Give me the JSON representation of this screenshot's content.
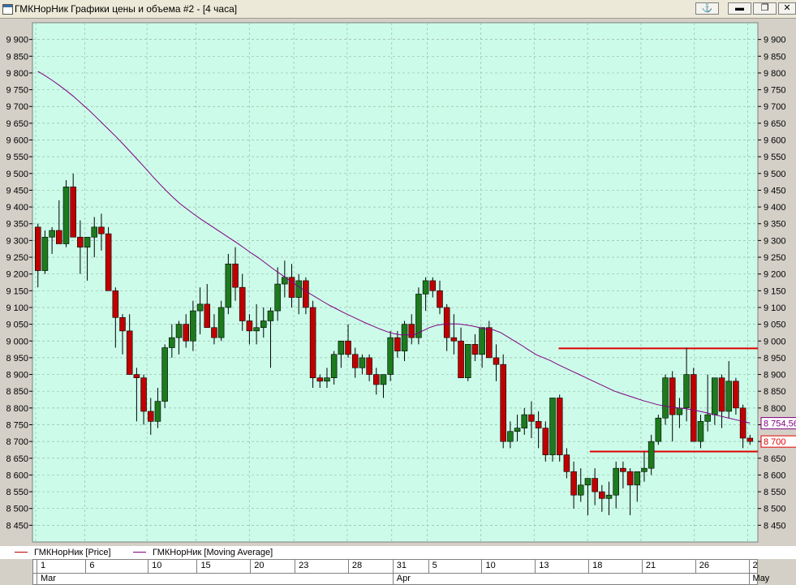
{
  "window": {
    "title": "ГМКНорНик Графики цены и объема #2 - [4 часа]"
  },
  "colors": {
    "background": "#ccfce9",
    "grid": "#9ab8ac",
    "up": "#1d7a1d",
    "down": "#c00000",
    "ma": "#800080",
    "level": "#e00000"
  },
  "chart_data": {
    "type": "candlestick",
    "title": "",
    "ylim": [
      8400,
      9950
    ],
    "y_ticks": [
      8450,
      8500,
      8550,
      8600,
      8650,
      8700,
      8750,
      8800,
      8850,
      8900,
      8950,
      9000,
      9050,
      9100,
      9150,
      9200,
      9250,
      9300,
      9350,
      9400,
      9450,
      9500,
      9550,
      9600,
      9650,
      9700,
      9750,
      9800,
      9850,
      9900
    ],
    "y_tick_labels": [
      "8 450",
      "8 500",
      "8 550",
      "8 600",
      "8 650",
      "8 700",
      "8 750",
      "8 800",
      "8 850",
      "8 900",
      "8 950",
      "9 000",
      "9 050",
      "9 100",
      "9 150",
      "9 200",
      "9 250",
      "9 300",
      "9 350",
      "9 400",
      "9 450",
      "9 500",
      "9 550",
      "9 600",
      "9 650",
      "9 700",
      "9 750",
      "9 800",
      "9 850",
      "9 900"
    ],
    "series": [
      {
        "name": "ГМКНорНик [Price]",
        "type": "candlestick",
        "candles": [
          [
            9340,
            9350,
            9160,
            9210
          ],
          [
            9210,
            9330,
            9200,
            9310
          ],
          [
            9310,
            9340,
            9260,
            9330
          ],
          [
            9330,
            9420,
            9300,
            9290
          ],
          [
            9290,
            9480,
            9280,
            9460
          ],
          [
            9460,
            9500,
            9320,
            9310
          ],
          [
            9310,
            9360,
            9200,
            9280
          ],
          [
            9280,
            9310,
            9180,
            9310
          ],
          [
            9310,
            9370,
            9250,
            9340
          ],
          [
            9340,
            9380,
            9270,
            9320
          ],
          [
            9320,
            9340,
            9180,
            9150
          ],
          [
            9150,
            9160,
            8980,
            9070
          ],
          [
            9070,
            9080,
            8960,
            9030
          ],
          [
            9030,
            9080,
            8980,
            8900
          ],
          [
            8900,
            8920,
            8760,
            8890
          ],
          [
            8890,
            8900,
            8750,
            8790
          ],
          [
            8790,
            8830,
            8720,
            8760
          ],
          [
            8760,
            8860,
            8740,
            8820
          ],
          [
            8820,
            8990,
            8800,
            8980
          ],
          [
            8980,
            9050,
            8950,
            9010
          ],
          [
            9010,
            9060,
            8960,
            9050
          ],
          [
            9050,
            9080,
            8980,
            9000
          ],
          [
            9000,
            9120,
            8970,
            9090
          ],
          [
            9090,
            9160,
            9020,
            9110
          ],
          [
            9110,
            9170,
            9060,
            9040
          ],
          [
            9040,
            9080,
            8990,
            9010
          ],
          [
            9010,
            9120,
            9000,
            9100
          ],
          [
            9100,
            9260,
            9080,
            9230
          ],
          [
            9230,
            9280,
            9120,
            9160
          ],
          [
            9160,
            9200,
            9030,
            9060
          ],
          [
            9060,
            9080,
            8990,
            9030
          ],
          [
            9030,
            9110,
            8990,
            9040
          ],
          [
            9040,
            9100,
            9010,
            9060
          ],
          [
            9060,
            9100,
            8920,
            9090
          ],
          [
            9090,
            9220,
            9060,
            9170
          ],
          [
            9170,
            9240,
            9130,
            9190
          ],
          [
            9190,
            9230,
            9100,
            9130
          ],
          [
            9130,
            9200,
            9080,
            9180
          ],
          [
            9180,
            9190,
            9080,
            9100
          ],
          [
            9100,
            9120,
            8860,
            8890
          ],
          [
            8890,
            8900,
            8860,
            8880
          ],
          [
            8880,
            8920,
            8860,
            8890
          ],
          [
            8890,
            8970,
            8870,
            8960
          ],
          [
            8960,
            9000,
            8920,
            9000
          ],
          [
            9000,
            9050,
            8950,
            8960
          ],
          [
            8960,
            8980,
            8890,
            8920
          ],
          [
            8920,
            8960,
            8900,
            8950
          ],
          [
            8950,
            8960,
            8880,
            8900
          ],
          [
            8900,
            8920,
            8840,
            8870
          ],
          [
            8870,
            8900,
            8830,
            8900
          ],
          [
            8900,
            9030,
            8880,
            9010
          ],
          [
            9010,
            9030,
            8950,
            8970
          ],
          [
            8970,
            9060,
            8940,
            9050
          ],
          [
            9050,
            9080,
            8990,
            9010
          ],
          [
            9010,
            9160,
            8990,
            9140
          ],
          [
            9140,
            9190,
            9090,
            9180
          ],
          [
            9180,
            9190,
            9130,
            9150
          ],
          [
            9150,
            9180,
            9080,
            9100
          ],
          [
            9100,
            9110,
            8970,
            9010
          ],
          [
            9010,
            9080,
            8960,
            9000
          ],
          [
            9000,
            9040,
            8910,
            8890
          ],
          [
            8890,
            8960,
            8880,
            8990
          ],
          [
            8990,
            9020,
            8940,
            8960
          ],
          [
            8960,
            9040,
            8920,
            9040
          ],
          [
            9040,
            9060,
            8950,
            8950
          ],
          [
            8950,
            8990,
            8880,
            8930
          ],
          [
            8930,
            8960,
            8680,
            8700
          ],
          [
            8700,
            8760,
            8680,
            8730
          ],
          [
            8730,
            8780,
            8700,
            8740
          ],
          [
            8740,
            8800,
            8720,
            8780
          ],
          [
            8780,
            8820,
            8710,
            8760
          ],
          [
            8760,
            8790,
            8680,
            8740
          ],
          [
            8740,
            8760,
            8640,
            8660
          ],
          [
            8660,
            8800,
            8640,
            8830
          ],
          [
            8830,
            8840,
            8640,
            8660
          ],
          [
            8660,
            8680,
            8590,
            8610
          ],
          [
            8610,
            8640,
            8500,
            8540
          ],
          [
            8540,
            8620,
            8520,
            8570
          ],
          [
            8570,
            8590,
            8480,
            8590
          ],
          [
            8590,
            8620,
            8510,
            8550
          ],
          [
            8550,
            8570,
            8490,
            8530
          ],
          [
            8530,
            8580,
            8480,
            8540
          ],
          [
            8540,
            8640,
            8500,
            8620
          ],
          [
            8620,
            8640,
            8560,
            8610
          ],
          [
            8610,
            8620,
            8480,
            8570
          ],
          [
            8570,
            8610,
            8520,
            8610
          ],
          [
            8610,
            8670,
            8580,
            8620
          ],
          [
            8620,
            8720,
            8600,
            8700
          ],
          [
            8700,
            8780,
            8690,
            8770
          ],
          [
            8770,
            8900,
            8750,
            8890
          ],
          [
            8890,
            8910,
            8700,
            8780
          ],
          [
            8780,
            8830,
            8740,
            8800
          ],
          [
            8800,
            8980,
            8760,
            8900
          ],
          [
            8900,
            8920,
            8700,
            8700
          ],
          [
            8700,
            8780,
            8680,
            8760
          ],
          [
            8760,
            8900,
            8730,
            8780
          ],
          [
            8780,
            8890,
            8750,
            8890
          ],
          [
            8890,
            8900,
            8740,
            8790
          ],
          [
            8790,
            8940,
            8770,
            8880
          ],
          [
            8880,
            8890,
            8780,
            8800
          ],
          [
            8800,
            8810,
            8680,
            8710
          ],
          [
            8710,
            8720,
            8690,
            8700
          ]
        ]
      },
      {
        "name": "ГМКНорНик [Moving Average]",
        "type": "line",
        "values": [
          9805,
          9792,
          9778,
          9763,
          9747,
          9730,
          9711,
          9692,
          9672,
          9651,
          9630,
          9609,
          9587,
          9564,
          9541,
          9518,
          9494,
          9471,
          9449,
          9428,
          9409,
          9393,
          9377,
          9362,
          9348,
          9334,
          9320,
          9306,
          9292,
          9277,
          9262,
          9248,
          9232,
          9216,
          9201,
          9186,
          9171,
          9157,
          9144,
          9131,
          9118,
          9106,
          9095,
          9084,
          9074,
          9064,
          9054,
          9045,
          9036,
          9028,
          9022,
          9018,
          9018,
          9020,
          9030,
          9040,
          9047,
          9050,
          9051,
          9051,
          9048,
          9045,
          9040,
          9035,
          9033,
          9025,
          9012,
          8999,
          8986,
          8972,
          8959,
          8950,
          8941,
          8930,
          8920,
          8910,
          8900,
          8890,
          8880,
          8870,
          8860,
          8850,
          8843,
          8836,
          8829,
          8822,
          8816,
          8810,
          8806,
          8802,
          8800,
          8798,
          8794,
          8790,
          8785,
          8780,
          8775,
          8770,
          8765,
          8760,
          8755
        ]
      }
    ],
    "horizontal_lines": [
      8978,
      8670
    ],
    "price_labels": [
      {
        "text": "8 754,56",
        "series": "ГМКНорНик [Moving Average]"
      },
      {
        "text": "8 700",
        "series": "ГМКНорНик [Price]"
      }
    ]
  },
  "legend": [
    {
      "label": "ГМКНорНик [Price]"
    },
    {
      "label": "ГМКНорНик [Moving Average]"
    }
  ],
  "x_axis": {
    "day_ticks": [
      "1",
      "6",
      "10",
      "15",
      "20",
      "23",
      "28",
      "31",
      "5",
      "10",
      "13",
      "18",
      "21",
      "26",
      "2"
    ],
    "day_tick_index": [
      0,
      11,
      25,
      36,
      48,
      58,
      70,
      80,
      88,
      100,
      112,
      124,
      136,
      148,
      160
    ],
    "months": [
      {
        "label": "Mar",
        "index": 0
      },
      {
        "label": "Apr",
        "index": 80
      },
      {
        "label": "May",
        "index": 160
      }
    ],
    "total_slots": 163
  }
}
